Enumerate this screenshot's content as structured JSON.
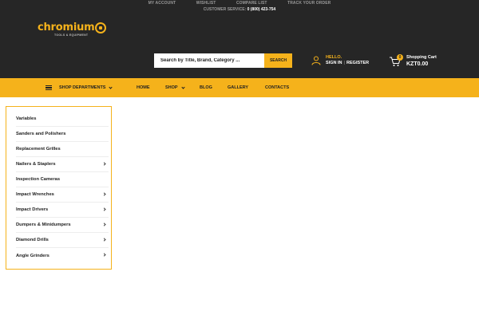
{
  "top_links": [
    "MY ACCOUNT",
    "WISHLIST",
    "COMPARE LIST",
    "TRACK YOUR ORDER"
  ],
  "customer_service": {
    "label": "CUSTOMER SERVICE:",
    "phone": "0 (800) 423-754"
  },
  "logo": {
    "name": "chromium",
    "tagline": "TOOLS & EQUIPMENT",
    "icon": "lightbulb-gear-icon"
  },
  "search": {
    "placeholder": "Search by Title, Brand, Category ...",
    "button_label": "SEARCH"
  },
  "user": {
    "greeting": "HELLO.",
    "sign_in": "SIGN IN",
    "register": "REGISTER",
    "icon": "user-icon"
  },
  "cart": {
    "label": "Shopping Cart",
    "total": "KZT0.00",
    "count": "0",
    "icon": "cart-icon"
  },
  "nav": {
    "departments_label": "SHOP DEPARTMENTS",
    "items": [
      {
        "label": "HOME",
        "has_dropdown": false
      },
      {
        "label": "SHOP",
        "has_dropdown": true
      },
      {
        "label": "BLOG",
        "has_dropdown": false
      },
      {
        "label": "GALLERY",
        "has_dropdown": false
      },
      {
        "label": "CONTACTS",
        "has_dropdown": false
      }
    ]
  },
  "departments": [
    {
      "label": "Variables",
      "has_submenu": false
    },
    {
      "label": "Sanders and Polishers",
      "has_submenu": false
    },
    {
      "label": "Replacement Grilles",
      "has_submenu": false
    },
    {
      "label": "Nailers & Staplers",
      "has_submenu": true
    },
    {
      "label": "Inspection Cameras",
      "has_submenu": false
    },
    {
      "label": "Impact Wrenches",
      "has_submenu": true
    },
    {
      "label": "Impact Drivers",
      "has_submenu": true
    },
    {
      "label": "Dumpers & Minidumpers",
      "has_submenu": true
    },
    {
      "label": "Diamond Drills",
      "has_submenu": true
    },
    {
      "label": "Angle Grinders",
      "has_submenu": true
    }
  ],
  "colors": {
    "accent": "#f5b21b",
    "header_bg": "#262626"
  }
}
